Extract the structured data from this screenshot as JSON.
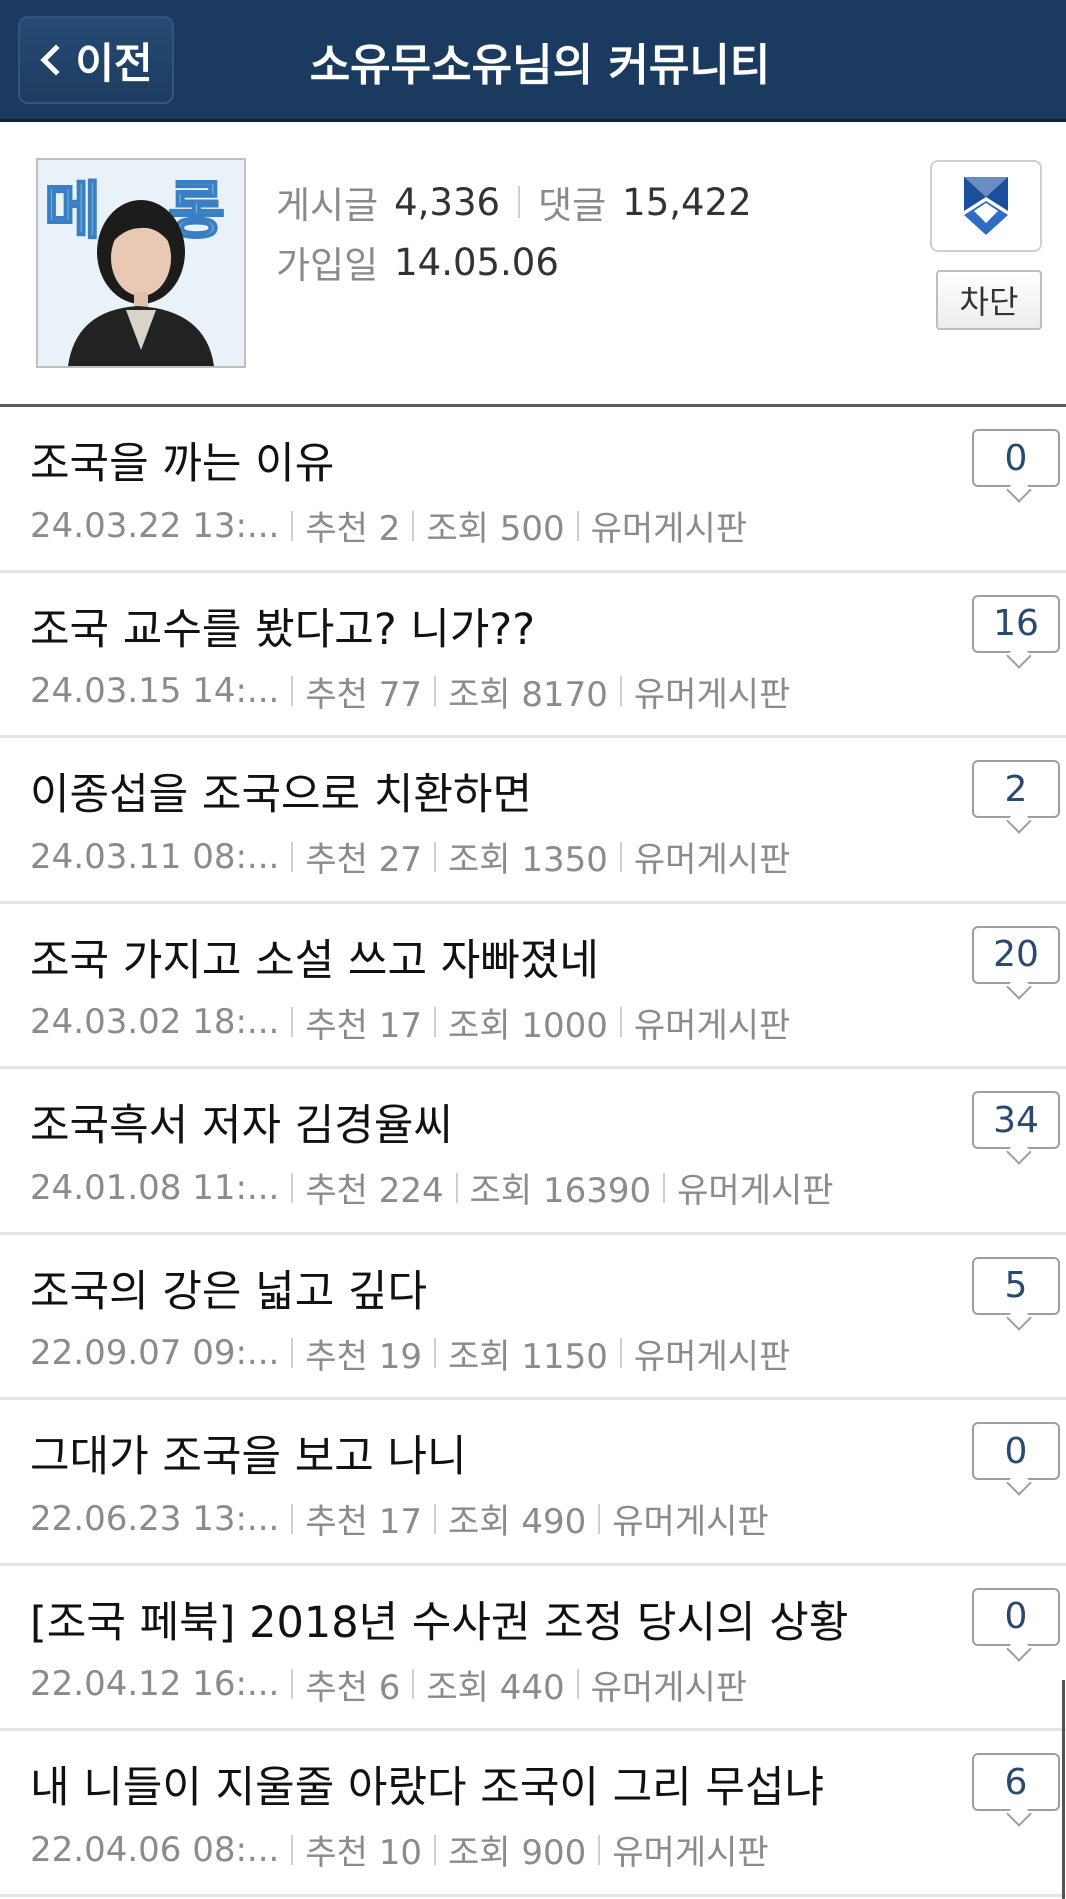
{
  "header": {
    "back_label": "이전",
    "title": "소유무소유님의 커뮤니티"
  },
  "profile": {
    "posts_label": "게시글",
    "posts_value": "4,336",
    "comments_label": "댓글",
    "comments_value": "15,422",
    "joined_label": "가입일",
    "joined_value": "14.05.06",
    "block_label": "차단",
    "avatar_text": "메롱"
  },
  "posts": [
    {
      "title": "조국을 까는 이유",
      "date": "24.03.22  13:...",
      "recommend": "추천 2",
      "views": "조회 500",
      "board": "유머게시판",
      "comments": "0"
    },
    {
      "title": "조국 교수를 봤다고? 니가??",
      "date": "24.03.15  14:...",
      "recommend": "추천 77",
      "views": "조회 8170",
      "board": "유머게시판",
      "comments": "16"
    },
    {
      "title": "이종섭을 조국으로 치환하면",
      "date": "24.03.11  08:...",
      "recommend": "추천 27",
      "views": "조회 1350",
      "board": "유머게시판",
      "comments": "2"
    },
    {
      "title": "조국 가지고 소설 쓰고 자빠졌네",
      "date": "24.03.02  18:...",
      "recommend": "추천 17",
      "views": "조회 1000",
      "board": "유머게시판",
      "comments": "20"
    },
    {
      "title": "조국흑서 저자 김경율씨",
      "date": "24.01.08  11:...",
      "recommend": "추천 224",
      "views": "조회 16390",
      "board": "유머게시판",
      "comments": "34"
    },
    {
      "title": "조국의 강은 넓고 깊다",
      "date": "22.09.07  09:...",
      "recommend": "추천 19",
      "views": "조회 1150",
      "board": "유머게시판",
      "comments": "5"
    },
    {
      "title": "그대가 조국을 보고 나니",
      "date": "22.06.23  13:...",
      "recommend": "추천 17",
      "views": "조회 490",
      "board": "유머게시판",
      "comments": "0"
    },
    {
      "title": "[조국 페북] 2018년 수사권 조정 당시의 상황",
      "date": "22.04.12  16:...",
      "recommend": "추천 6",
      "views": "조회 440",
      "board": "유머게시판",
      "comments": "0"
    },
    {
      "title": "내 니들이 지울줄 아랐다 조국이 그리 무섭냐",
      "date": "22.04.06  08:...",
      "recommend": "추천 10",
      "views": "조회 900",
      "board": "유머게시판",
      "comments": "6"
    }
  ],
  "colors": {
    "header_bg": "#1b3a5f",
    "badge_text": "#2a4a6d",
    "meta_text": "#8b8b8b"
  },
  "icons": {
    "back": "chevron-left-icon",
    "bookmark": "bookmark-icon",
    "comment": "speech-bubble-icon"
  }
}
